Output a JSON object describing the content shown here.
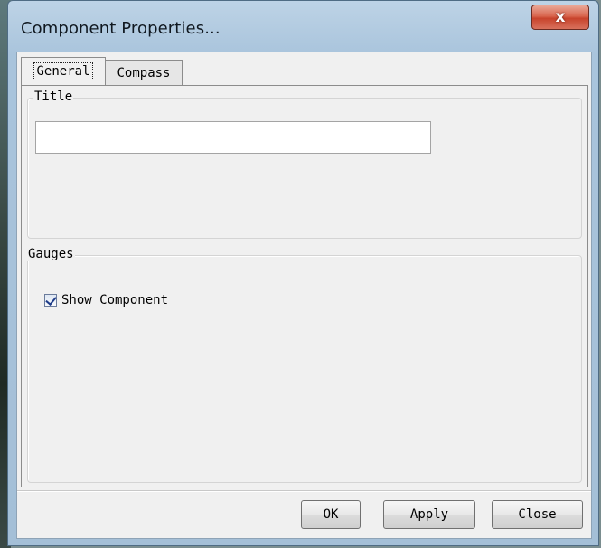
{
  "window": {
    "title": "Component Properties...",
    "close_symbol": "x"
  },
  "tabs": [
    {
      "label": "General",
      "active": true
    },
    {
      "label": "Compass",
      "active": false
    }
  ],
  "general": {
    "title_group": {
      "label": "Title",
      "input_value": "",
      "input_placeholder": ""
    },
    "gauges_group": {
      "label": "Gauges",
      "show_component_label": "Show Component",
      "show_component_checked": true
    }
  },
  "buttons": {
    "ok": "OK",
    "apply": "Apply",
    "close": "Close"
  }
}
